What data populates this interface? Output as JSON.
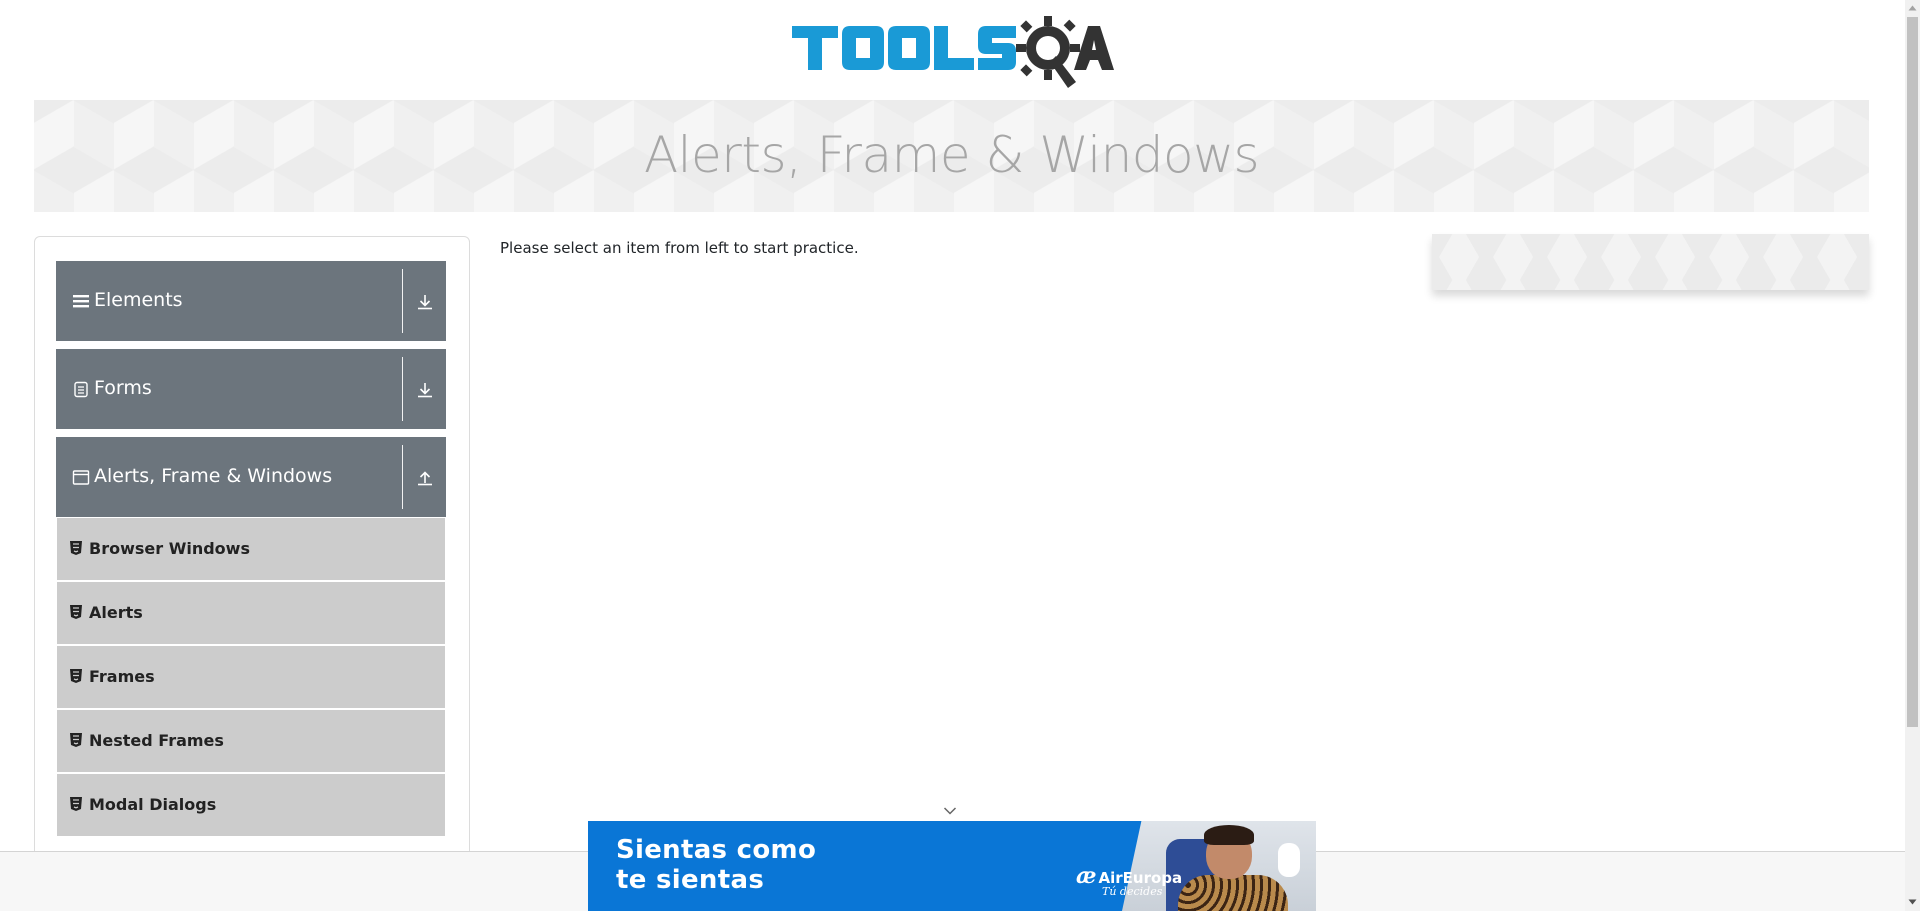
{
  "logo": {
    "text": "TOOLSQA",
    "brand_blue": "#1a9ad6",
    "brand_dark": "#333333"
  },
  "banner": {
    "title": "Alerts, Frame & Windows"
  },
  "sidebar": {
    "groups": [
      {
        "label": "Elements",
        "icon": "hamburger-icon",
        "arrow": "download-arrow-icon",
        "expanded": false
      },
      {
        "label": "Forms",
        "icon": "document-icon",
        "arrow": "download-arrow-icon",
        "expanded": false
      },
      {
        "label": "Alerts, Frame & Windows",
        "icon": "window-icon",
        "arrow": "upload-arrow-icon",
        "expanded": true
      }
    ],
    "items": [
      {
        "label": "Browser Windows",
        "icon": "html5-icon"
      },
      {
        "label": "Alerts",
        "icon": "html5-icon"
      },
      {
        "label": "Frames",
        "icon": "html5-icon"
      },
      {
        "label": "Nested Frames",
        "icon": "html5-icon"
      },
      {
        "label": "Modal Dialogs",
        "icon": "html5-icon"
      }
    ],
    "colors": {
      "group_bg": "#6c757d",
      "item_bg": "#cccccc"
    }
  },
  "main": {
    "message": "Please select an item from left to start practice."
  },
  "ad": {
    "line1": "Sientas como",
    "line2": "te sientas",
    "brand_mark": "æ",
    "brand": "AirEuropa",
    "tagline": "Tú decides",
    "bg_color": "#0a76d6"
  }
}
